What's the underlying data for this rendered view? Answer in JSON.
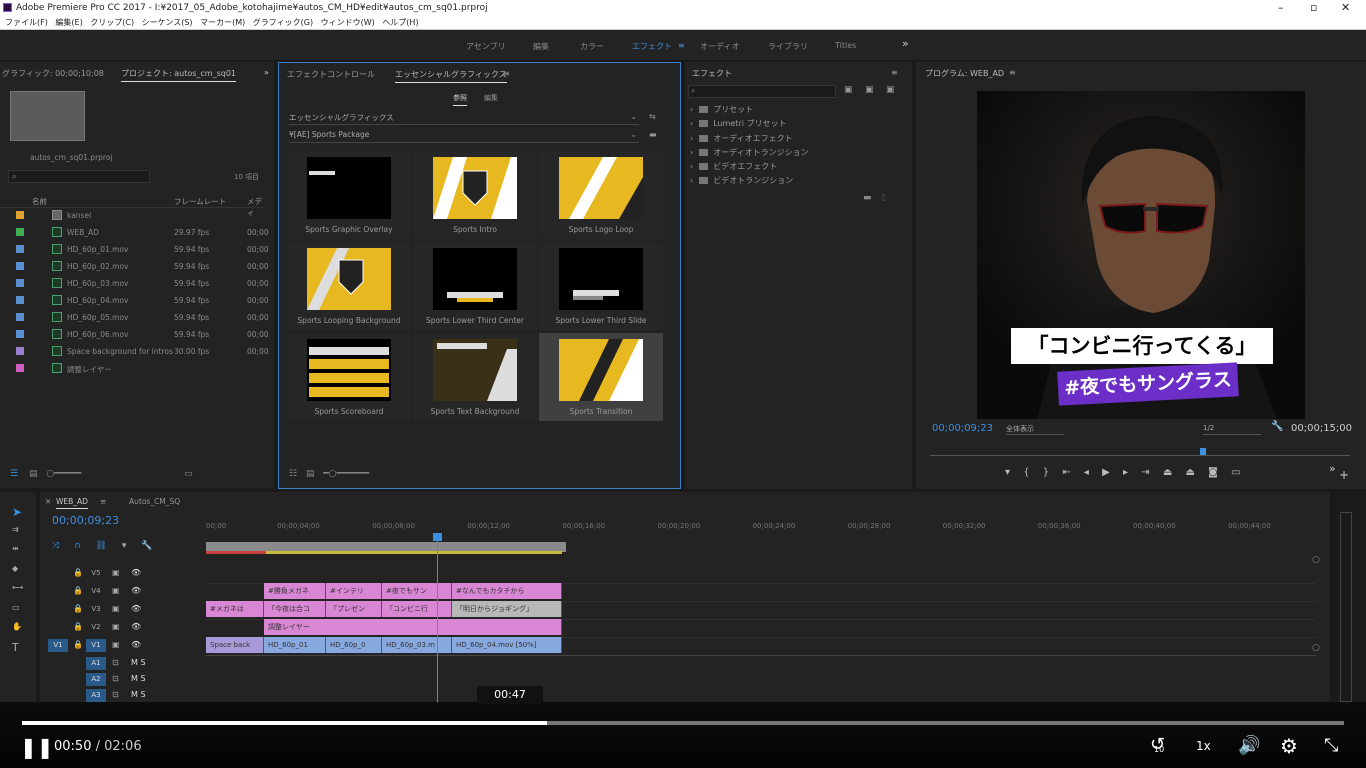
{
  "window": {
    "title": "Adobe Premiere Pro CC 2017 - I:¥2017_05_Adobe_kotohajime¥autos_CM_HD¥edit¥autos_cm_sq01.prproj"
  },
  "menu": [
    "ファイル(F)",
    "編集(E)",
    "クリップ(C)",
    "シーケンス(S)",
    "マーカー(M)",
    "グラフィック(G)",
    "ウィンドウ(W)",
    "ヘルプ(H)"
  ],
  "workspaces": [
    "アセンブリ",
    "編集",
    "カラー",
    "エフェクト",
    "オーディオ",
    "ライブラリ",
    "Titles"
  ],
  "project": {
    "tab_graphics": "グラフィック: 00;00;10;08",
    "tab": "プロジェクト: autos_cm_sq01",
    "file": "autos_cm_sq01.prproj",
    "count": "10 項目",
    "col_name": "名前",
    "col_rate": "フレームレート",
    "col_media": "メディ",
    "items": [
      {
        "name": "kansei",
        "rate": "",
        "media": "",
        "color": "#e0a030"
      },
      {
        "name": "WEB_AD",
        "rate": "29.97 fps",
        "media": "00;00",
        "color": "#3ab050"
      },
      {
        "name": "HD_60p_01.mov",
        "rate": "59.94 fps",
        "media": "00;00",
        "color": "#5a8fd0"
      },
      {
        "name": "HD_60p_02.mov",
        "rate": "59.94 fps",
        "media": "00;00",
        "color": "#5a8fd0"
      },
      {
        "name": "HD_60p_03.mov",
        "rate": "59.94 fps",
        "media": "00;00",
        "color": "#5a8fd0"
      },
      {
        "name": "HD_60p_04.mov",
        "rate": "59.94 fps",
        "media": "00;00",
        "color": "#5a8fd0"
      },
      {
        "name": "HD_60p_05.mov",
        "rate": "59.94 fps",
        "media": "00;00",
        "color": "#5a8fd0"
      },
      {
        "name": "HD_60p_06.mov",
        "rate": "59.94 fps",
        "media": "00;00",
        "color": "#5a8fd0"
      },
      {
        "name": "Space background for intros",
        "rate": "30.00 fps",
        "media": "00;00",
        "color": "#9a7fd0"
      },
      {
        "name": "調整レイヤー",
        "rate": "",
        "media": "",
        "color": "#d060c0"
      }
    ]
  },
  "eg": {
    "tab_ec": "エフェクトコントロール",
    "tab": "エッセンシャルグラフィックス",
    "sub_browse": "参照",
    "sub_edit": "編集",
    "dropdown1": "エッセンシャルグラフィックス",
    "dropdown2": "¥[AE] Sports Package",
    "tiles": [
      "Sports Graphic Overlay",
      "Sports Intro",
      "Sports Logo Loop",
      "Sports Looping Background",
      "Sports Lower Third Center",
      "Sports Lower Third Slide",
      "Sports Scoreboard",
      "Sports Text Background",
      "Sports Transition"
    ]
  },
  "effects": {
    "tab": "エフェクト",
    "folders": [
      "プリセット",
      "Lumetri プリセット",
      "オーディオエフェクト",
      "オーディオトランジション",
      "ビデオエフェクト",
      "ビデオトランジション"
    ]
  },
  "program": {
    "tab": "プログラム: WEB_AD",
    "caption1": "「コンビニ行ってくる」",
    "caption2": "#夜でもサングラス",
    "timecode": "00;00;09;23",
    "fit": "全体表示",
    "res": "1/2",
    "duration": "00;00;15;00"
  },
  "timeline": {
    "tab1": "WEB_AD",
    "tab2": "Autos_CM_SQ",
    "timecode": "00;00;09;23",
    "ruler": [
      "00;00",
      "00;00;04;00",
      "00;00;08;00",
      "00;00;12;00",
      "00;00;16;00",
      "00;00;20;00",
      "00;00;24;00",
      "00;00;28;00",
      "00;00;32;00",
      "00;00;36;00",
      "00;00;40;00",
      "00;00;44;00"
    ],
    "tracks": [
      "V5",
      "V4",
      "V3",
      "V2",
      "V1",
      "A1",
      "A2",
      "A3"
    ],
    "src": "V1",
    "clips": {
      "v4a": "#勝負メガネ",
      "v4b": "#インテリ",
      "v4c": "#夜でもサン",
      "v4d": "#なんでもカタチから",
      "v3a": "#メガネは",
      "v3b": "「今夜は合コ",
      "v3c": "「プレゼン",
      "v3d": "「コンビニ行",
      "v3e": "「明日からジョギング」",
      "v2a": "調整レイヤー",
      "v1a": "Space back",
      "v1b": "HD_60p_01",
      "v1c": "HD_60p_0",
      "v1d": "HD_60p_03.m",
      "v1e": "HD_60p_04.mov [50%]"
    }
  },
  "player": {
    "tooltip": "00:47",
    "current": "00:50",
    "sep": " / ",
    "total": "02:06",
    "speed": "1x",
    "skip": "10",
    "progress_fraction": 0.397
  }
}
